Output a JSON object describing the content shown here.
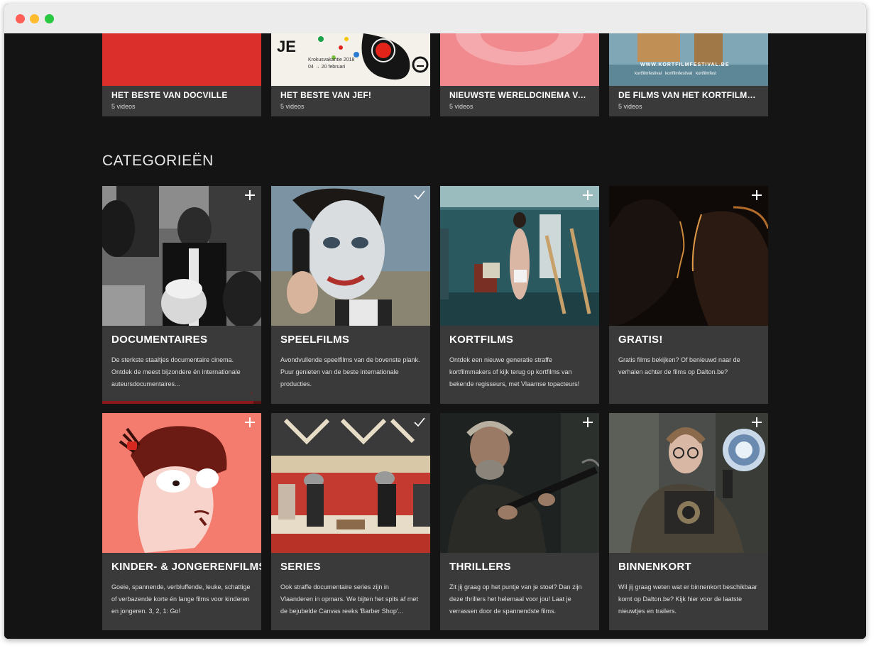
{
  "window": {
    "controls": [
      "close",
      "minimize",
      "maximize"
    ]
  },
  "playlists": [
    {
      "title": "HET BESTE VAN DOCVILLE",
      "count": "5 videos"
    },
    {
      "title": "HET BESTE VAN JEF!",
      "count": "5 videos",
      "poster_text": [
        "Krokusvakantie 2018",
        "04 → 20 februari"
      ]
    },
    {
      "title": "NIEUWSTE WERELDCINEMA VAN MOOOV",
      "count": "5 videos"
    },
    {
      "title": "DE FILMS VAN HET KORTFILMFESTIVAL",
      "count": "5 videos",
      "poster_text": [
        "WWW.KORTFILMFESTIVAL.BE",
        "kortfilmfestival",
        "kortfilmfestival",
        "kortfilmfest"
      ]
    }
  ],
  "section_title": "CATEGORIEËN",
  "categories": [
    {
      "title": "DOCUMENTAIRES",
      "description": "De sterkste staaltjes documentaire cinema. Ontdek de meest bijzondere én internationale auteursdocumentaires...",
      "status_icon": "plus-icon",
      "progress": 0.95
    },
    {
      "title": "SPEELFILMS",
      "description": "Avondvullende speelfilms van de bovenste plank. Puur genieten van de beste internationale producties.",
      "status_icon": "check-icon"
    },
    {
      "title": "KORTFILMS",
      "description": "Ontdek een nieuwe generatie straffe kortfilmmakers of kijk terug op kortfilms van bekende regisseurs, met Vlaamse topacteurs!",
      "status_icon": "plus-icon"
    },
    {
      "title": "GRATIS!",
      "description": "Gratis films bekijken? Of benieuwd naar de verhalen achter de films op Dalton.be?",
      "status_icon": "plus-icon"
    },
    {
      "title": "KINDER- & JONGERENFILMS",
      "description": "Goeie, spannende, verbluffende, leuke, schattige of verbazende korte én lange films voor kinderen en jongeren. 3, 2, 1: Go!",
      "status_icon": "plus-icon"
    },
    {
      "title": "SERIES",
      "description": "Ook straffe documentaire series zijn in Vlaanderen in opmars. We bijten het spits af met de bejubelde Canvas reeks 'Barber Shop'...",
      "status_icon": "check-icon"
    },
    {
      "title": "THRILLERS",
      "description": "Zit jij graag op het puntje van je stoel? Dan zijn deze thrillers het helemaal voor jou! Laat je verrassen door de spannendste films.",
      "status_icon": "plus-icon"
    },
    {
      "title": "BINNENKORT",
      "description": "Wil jij graag weten wat er binnenkort beschikbaar komt op Dalton.be? Kijk hier voor de laatste nieuwtjes en trailers.",
      "status_icon": "plus-icon"
    }
  ],
  "colors": {
    "background": "#141414",
    "card": "#3a3a3a",
    "accent": "#8a1a1a",
    "text": "#ffffff"
  }
}
